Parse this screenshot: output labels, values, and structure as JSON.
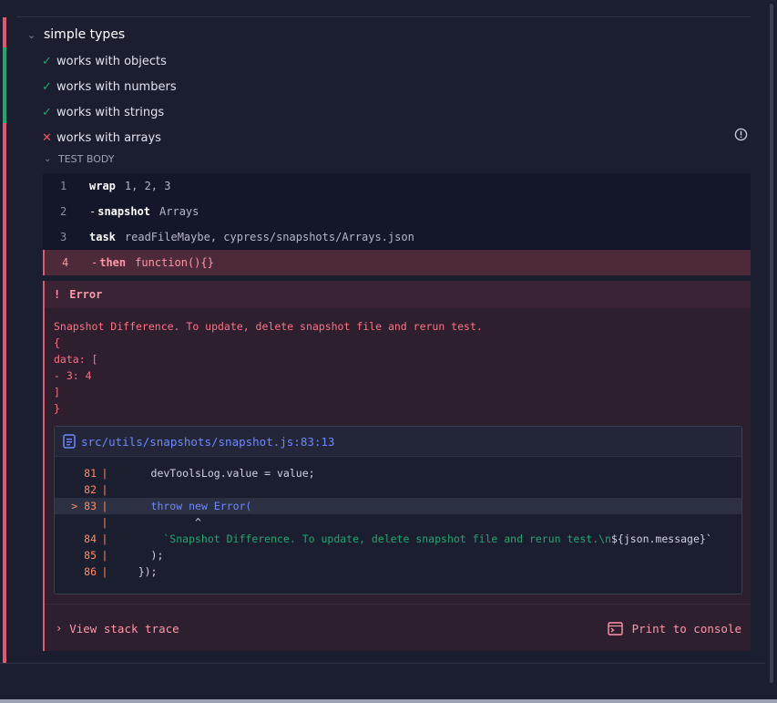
{
  "suite": {
    "title": "simple types"
  },
  "tests": [
    {
      "title": "works with objects",
      "state": "passed"
    },
    {
      "title": "works with numbers",
      "state": "passed"
    },
    {
      "title": "works with strings",
      "state": "passed"
    },
    {
      "title": "works with arrays",
      "state": "failed"
    }
  ],
  "test_body": {
    "label": "TEST BODY",
    "commands": [
      {
        "num": "1",
        "name": "wrap",
        "message": "1, 2, 3",
        "child": false
      },
      {
        "num": "2",
        "name": "snapshot",
        "message": "Arrays",
        "child": true
      },
      {
        "num": "3",
        "name": "task",
        "message": "readFileMaybe, cypress/snapshots/Arrays.json",
        "child": false
      },
      {
        "num": "4",
        "name": "then",
        "message": "function(){}",
        "child": true
      }
    ]
  },
  "error": {
    "bang": "!",
    "title": "Error",
    "message_lines": [
      "Snapshot Difference. To update, delete snapshot file and rerun test.",
      "{",
      "data: [",
      "- 3: 4",
      "]",
      "}"
    ],
    "code_frame": {
      "file": "src/utils/snapshots/snapshot.js:83:13",
      "lines": [
        {
          "marker": "",
          "num": "81",
          "code": "      devToolsLog.value = value;"
        },
        {
          "marker": "",
          "num": "82",
          "code": ""
        },
        {
          "marker": ">",
          "num": "83",
          "code_kw1": "      throw",
          "code_kw2": " new",
          "code_rest": " Error("
        },
        {
          "marker": "",
          "num": "",
          "caret": "             ^"
        },
        {
          "marker": "",
          "num": "84",
          "code_str": "        `Snapshot Difference. To update, delete snapshot file and rerun test.\\n",
          "code_tail": "${json.message}`"
        },
        {
          "marker": "",
          "num": "85",
          "code": "      );"
        },
        {
          "marker": "",
          "num": "86",
          "code": "    });"
        }
      ]
    },
    "view_stack_trace": "View stack trace",
    "print_to_console": "Print to console"
  },
  "colors": {
    "failed": "#e45770",
    "passed": "#1fa971",
    "link": "#6e89ff"
  }
}
